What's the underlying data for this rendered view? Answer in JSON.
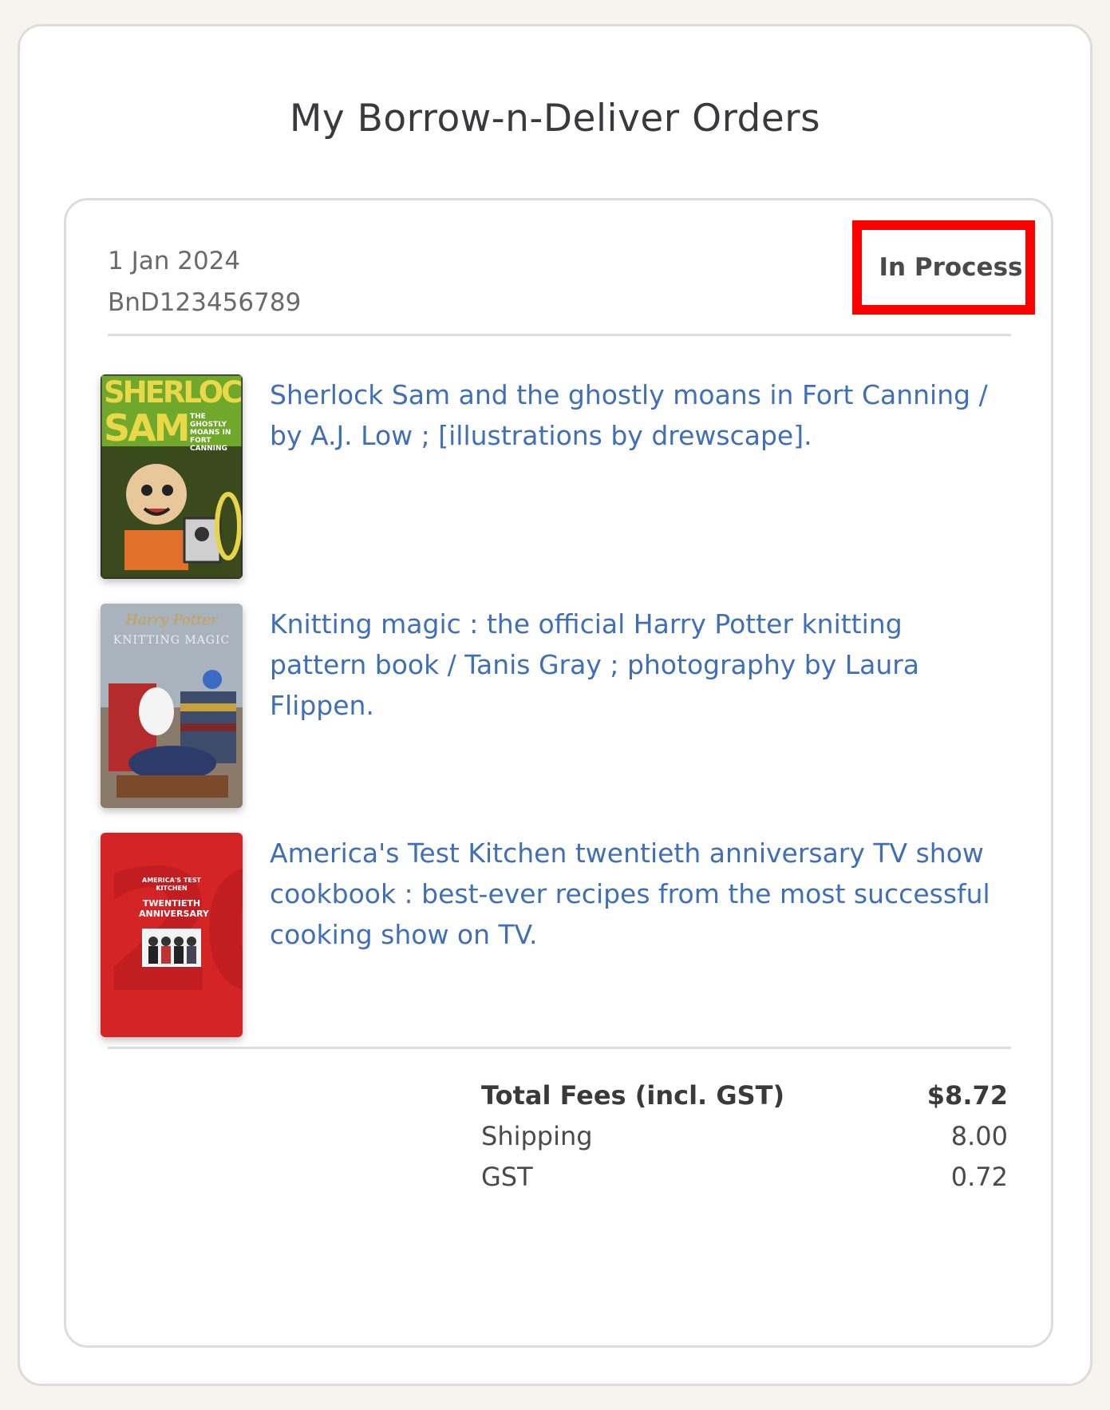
{
  "page": {
    "title": "My Borrow-n-Deliver Orders"
  },
  "order": {
    "date": "1 Jan 2024",
    "id": "BnD123456789",
    "status": "In Process",
    "items": [
      {
        "title": "Sherlock Sam and the ghostly moans in Fort Canning / by A.J. Low ; [illustrations by drewscape].",
        "cover": {
          "line1": "SHERLOCK",
          "line2": "SAM",
          "side": "THE GHOSTLY MOANS IN FORT CANNING"
        }
      },
      {
        "title": "Knitting magic : the official Harry Potter knitting pattern book / Tanis Gray ; photography by Laura Flippen.",
        "cover": {
          "line1": "Harry Potter",
          "line2": "KNITTING MAGIC"
        }
      },
      {
        "title": "America's Test Kitchen twentieth anniversary TV show cookbook : best-ever recipes from the most successful cooking show on TV.",
        "cover": {
          "line1": "AMERICA'S TEST KITCHEN",
          "line2": "TWENTIETH ANNIVERSARY",
          "big": "20"
        }
      }
    ]
  },
  "fees": {
    "total_label": "Total Fees (incl. GST)",
    "total_value": "$8.72",
    "shipping_label": "Shipping",
    "shipping_value": "8.00",
    "gst_label": "GST",
    "gst_value": "0.72"
  },
  "colors": {
    "link": "#3f6fb6",
    "highlight": "#ff0000"
  }
}
